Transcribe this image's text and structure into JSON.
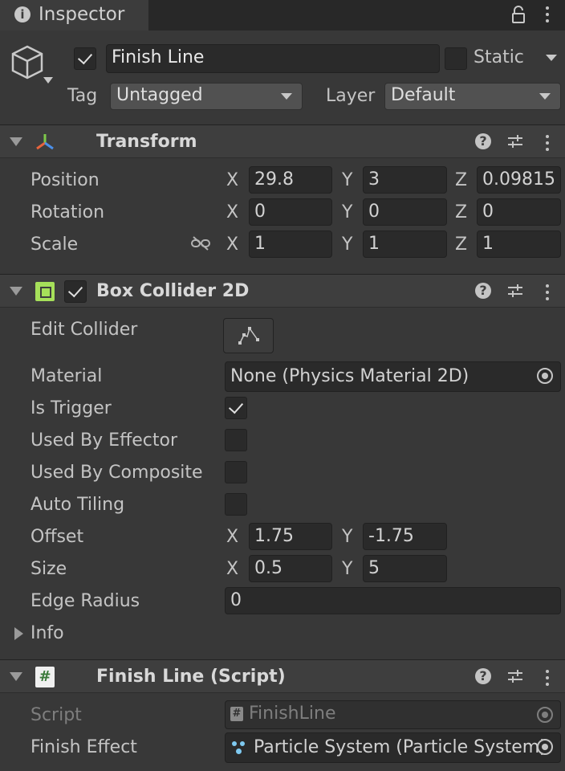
{
  "tab": {
    "title": "Inspector"
  },
  "object": {
    "name": "Finish Line",
    "static_label": "Static",
    "tag_label": "Tag",
    "tag_value": "Untagged",
    "layer_label": "Layer",
    "layer_value": "Default",
    "active": true,
    "static": false
  },
  "transform": {
    "title": "Transform",
    "position": {
      "label": "Position",
      "x": "29.8",
      "y": "3",
      "z": "0.09815"
    },
    "rotation": {
      "label": "Rotation",
      "x": "0",
      "y": "0",
      "z": "0"
    },
    "scale": {
      "label": "Scale",
      "x": "1",
      "y": "1",
      "z": "1"
    },
    "axes": {
      "x": "X",
      "y": "Y",
      "z": "Z"
    }
  },
  "box_collider": {
    "title": "Box Collider 2D",
    "enabled": true,
    "edit_collider": "Edit Collider",
    "material_label": "Material",
    "material_value": "None (Physics Material 2D)",
    "is_trigger_label": "Is Trigger",
    "is_trigger": true,
    "used_by_effector_label": "Used By Effector",
    "used_by_composite_label": "Used By Composite",
    "auto_tiling_label": "Auto Tiling",
    "offset": {
      "label": "Offset",
      "x": "1.75",
      "y": "-1.75"
    },
    "size": {
      "label": "Size",
      "x": "0.5",
      "y": "5"
    },
    "edge_radius": {
      "label": "Edge Radius",
      "value": "0"
    },
    "info_label": "Info"
  },
  "script": {
    "title": "Finish Line (Script)",
    "script_label": "Script",
    "script_value": "FinishLine",
    "finish_effect_label": "Finish Effect",
    "finish_effect_value": "Particle System (Particle System)"
  },
  "colors": {
    "background": "#383838",
    "header": "#3e3e3e",
    "field": "#2a2a2a",
    "collider_icon": "#a6e05a"
  }
}
